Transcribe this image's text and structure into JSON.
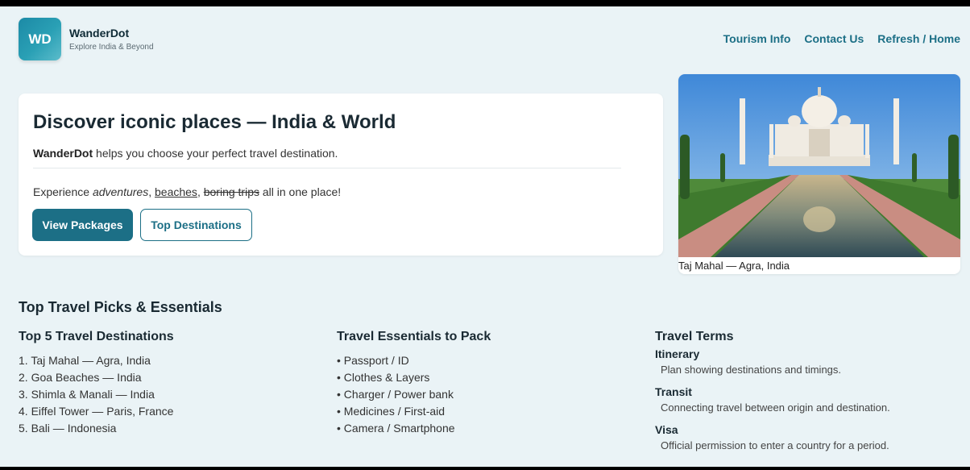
{
  "header": {
    "logo_text": "WD",
    "brand_name": "WanderDot",
    "brand_tagline": "Explore India & Beyond",
    "nav": [
      {
        "label": "Tourism Info"
      },
      {
        "label": "Contact Us"
      },
      {
        "label": "Refresh / Home"
      }
    ]
  },
  "hero": {
    "title": "Discover iconic places — India & World",
    "intro_brand": "WanderDot",
    "intro_rest": " helps you choose your perfect travel destination.",
    "tagline_prefix": "Experience ",
    "tagline_adventures": "adventures",
    "tagline_sep1": ", ",
    "tagline_beaches": "beaches",
    "tagline_sep2": ", ",
    "tagline_boring": "boring trips",
    "tagline_suffix": " all in one place!",
    "primary_button": "View Packages",
    "secondary_button": "Top Destinations"
  },
  "photo": {
    "caption": "Taj Mahal — Agra, India"
  },
  "section": {
    "title": "Top Travel Picks & Essentials",
    "destinations": {
      "heading": "Top 5 Travel Destinations",
      "items": [
        "1. Taj Mahal — Agra, India",
        "2. Goa Beaches — India",
        "3. Shimla & Manali — India",
        "4. Eiffel Tower — Paris, France",
        "5. Bali — Indonesia"
      ]
    },
    "essentials": {
      "heading": "Travel Essentials to Pack",
      "items": [
        "• Passport / ID",
        "• Clothes & Layers",
        "• Charger / Power bank",
        "• Medicines / First-aid",
        "• Camera / Smartphone"
      ]
    },
    "terms": {
      "heading": "Travel Terms",
      "items": [
        {
          "term": "Itinerary",
          "definition": "Plan showing destinations and timings."
        },
        {
          "term": "Transit",
          "definition": "Connecting travel between origin and destination."
        },
        {
          "term": "Visa",
          "definition": "Official permission to enter a country for a period."
        }
      ]
    }
  },
  "colors": {
    "accent": "#1c6f86",
    "background": "#eaf3f6"
  }
}
